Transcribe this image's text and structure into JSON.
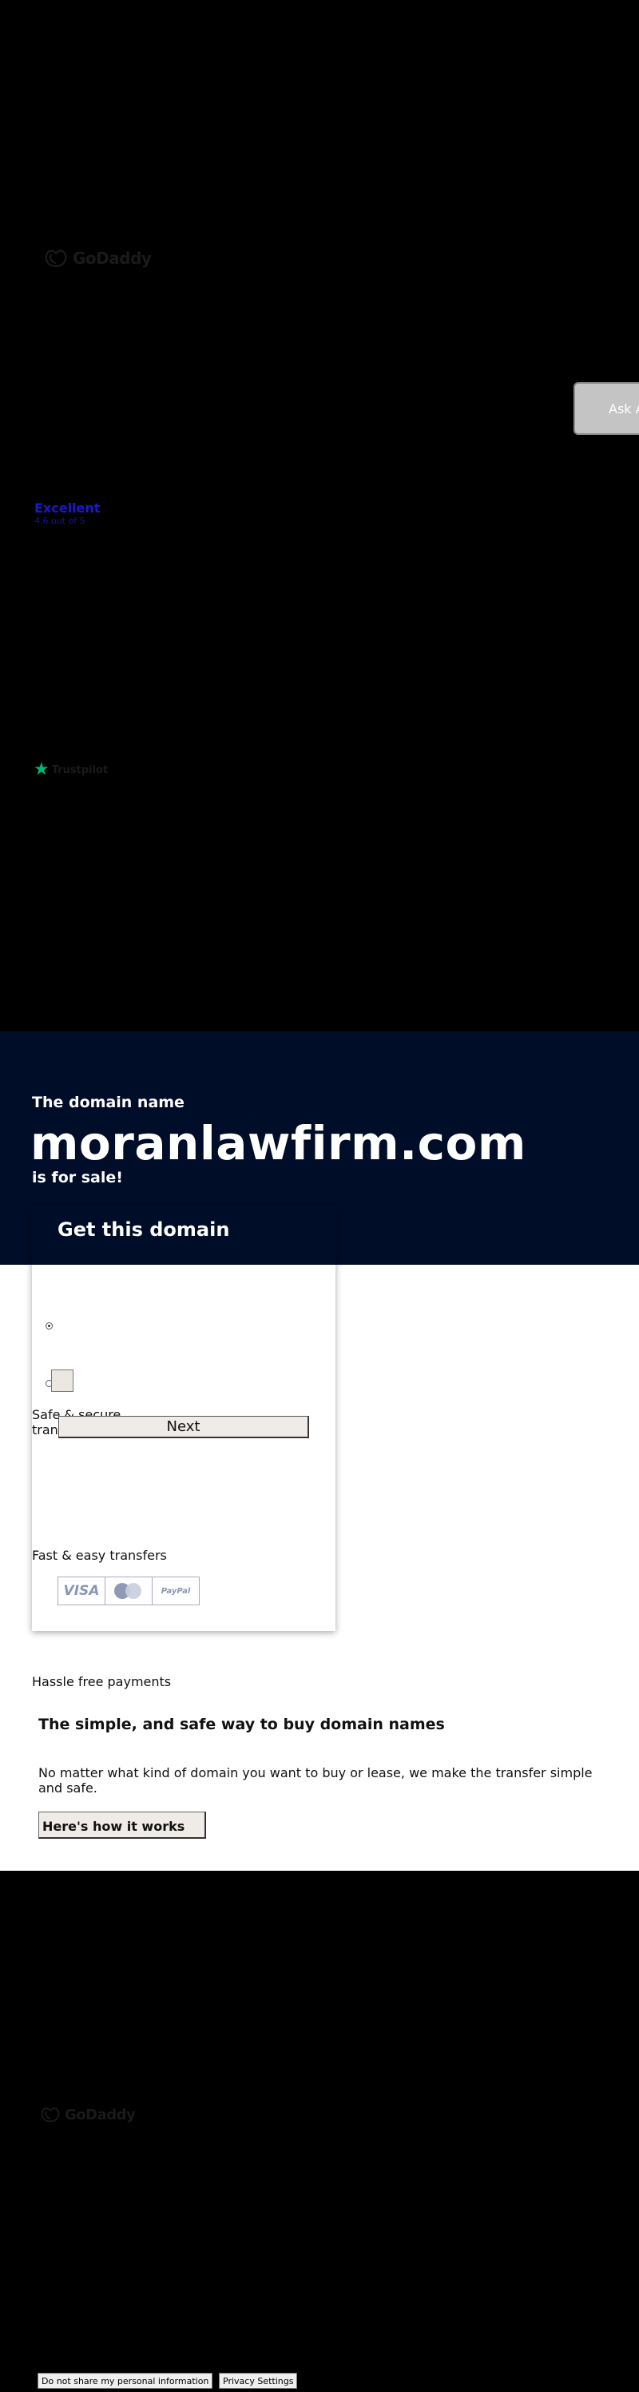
{
  "brand": {
    "logo_text": "GoDaddy",
    "icon": "godaddy-logo-icon"
  },
  "ask_button": {
    "label": "Ask A"
  },
  "rating": {
    "title": "Excellent",
    "subtitle": "4.6 out of 5"
  },
  "trustpilot": {
    "label": "Trustpilot",
    "icon": "star-icon",
    "color": "#00b67a"
  },
  "hero": {
    "pre": "The domain name",
    "domain": "moranlawfirm.com",
    "post": "is for sale!",
    "bg_color": "#000d28"
  },
  "card": {
    "title": "Get this domain",
    "next_label": "Next",
    "options": [
      {
        "checked": true
      },
      {
        "checked": false
      }
    ]
  },
  "features": [
    {
      "label": "Safe & secure transactions"
    },
    {
      "label": "Fast & easy transfers"
    },
    {
      "label": "Hassle free payments"
    }
  ],
  "payments": [
    {
      "name": "VISA",
      "icon": "visa-icon"
    },
    {
      "name": "",
      "icon": "mastercard-icon"
    },
    {
      "name": "PayPal",
      "icon": "paypal-icon"
    }
  ],
  "info": {
    "title": "The simple, and safe way to buy domain names",
    "description": "No matter what kind of domain you want to buy or lease, we make the transfer simple and safe.",
    "button_label": "Here's how it works"
  },
  "footer": {
    "do_not_share": "Do not share my personal information",
    "privacy_settings": "Privacy Settings"
  }
}
